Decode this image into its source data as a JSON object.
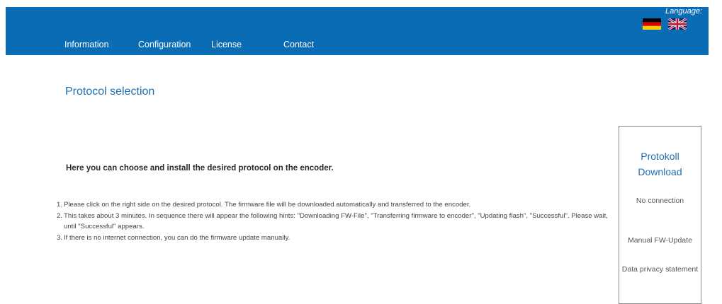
{
  "nav": {
    "items": [
      {
        "label": "Information"
      },
      {
        "label": "Configuration"
      },
      {
        "label": "License"
      },
      {
        "label": "Contact"
      }
    ]
  },
  "language": {
    "label": "Language:",
    "flags": [
      "german-flag-icon",
      "uk-flag-icon"
    ]
  },
  "main": {
    "title": "Protocol selection",
    "intro": "Here you can choose and install the desired protocol on the encoder.",
    "steps": [
      {
        "num": "1.",
        "text": "Please click on the right side on the desired protocol. The firmware file will be downloaded automatically and transferred to the encoder."
      },
      {
        "num": "2.",
        "text": "This takes about 3 minutes. In sequence there will appear the following hints: \"Downloading FW-File\", \"Transferring firmware to encoder\", \"Updating flash\", \"Successful\". Please wait, until \"Successful\" appears."
      },
      {
        "num": "3.",
        "text": "If there is no internet connection, you can do the firmware update manually."
      }
    ]
  },
  "sidebar": {
    "title": "Protokoll Download",
    "status": "No connection",
    "manual_update": "Manual FW-Update",
    "privacy": "Data privacy statement"
  },
  "colors": {
    "header_bg": "#0a6cb5",
    "title": "#1f6fb4"
  }
}
